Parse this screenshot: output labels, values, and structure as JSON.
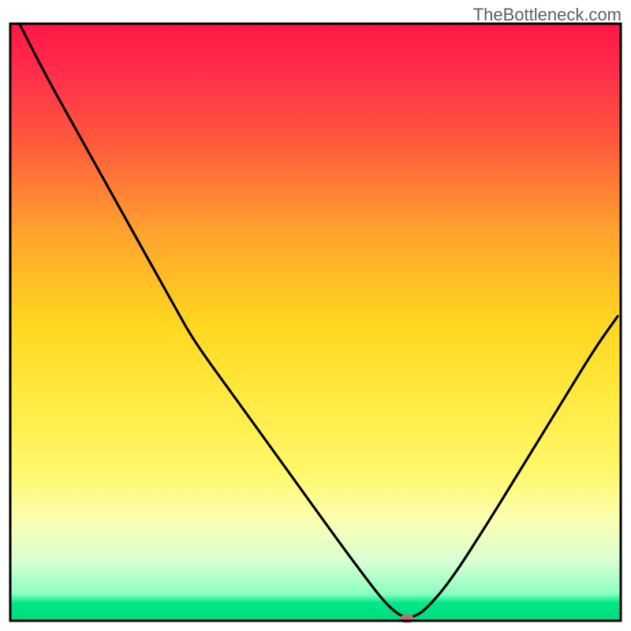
{
  "watermark": "TheBottleneck.com",
  "chart_data": {
    "type": "line",
    "title": "",
    "xlabel": "",
    "ylabel": "",
    "xlim": [
      0,
      100
    ],
    "ylim": [
      0,
      100
    ],
    "background_gradient": {
      "stops": [
        {
          "offset": 0.0,
          "color": "#ff1744"
        },
        {
          "offset": 0.08,
          "color": "#ff2d4a"
        },
        {
          "offset": 0.2,
          "color": "#ff5a3c"
        },
        {
          "offset": 0.35,
          "color": "#ffa32e"
        },
        {
          "offset": 0.5,
          "color": "#ffd61f"
        },
        {
          "offset": 0.62,
          "color": "#ffe93e"
        },
        {
          "offset": 0.75,
          "color": "#fff86a"
        },
        {
          "offset": 0.83,
          "color": "#fbffb0"
        },
        {
          "offset": 0.9,
          "color": "#d9ffd2"
        },
        {
          "offset": 0.955,
          "color": "#8affc0"
        },
        {
          "offset": 0.97,
          "color": "#00e889"
        },
        {
          "offset": 1.0,
          "color": "#00d97e"
        }
      ]
    },
    "series": [
      {
        "name": "bottleneck-curve",
        "color": "#000000",
        "x": [
          1.5,
          6,
          12,
          18,
          24,
          27,
          30,
          36,
          42,
          48,
          54,
          58,
          61,
          63,
          64.5,
          66,
          68,
          72,
          78,
          84,
          90,
          96,
          99.5
        ],
        "y": [
          100,
          91,
          80,
          69,
          58,
          52.5,
          47,
          38.5,
          30,
          21.5,
          13,
          7.5,
          3.5,
          1.5,
          0.6,
          0.6,
          1.8,
          6.5,
          16,
          26,
          36,
          46,
          51
        ]
      }
    ],
    "marker": {
      "name": "optimal-point",
      "x": 65,
      "y": 0,
      "color": "#c96a6a",
      "width": 2.2,
      "height": 1.2
    },
    "axes": {
      "frame_color": "#000000",
      "frame_thickness": 3
    }
  }
}
